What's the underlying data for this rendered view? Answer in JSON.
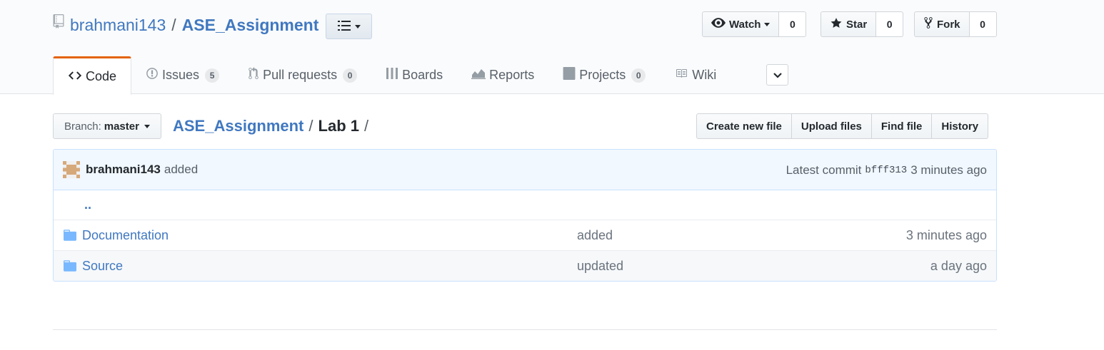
{
  "repo": {
    "owner": "brahmani143",
    "separator": "/",
    "name": "ASE_Assignment"
  },
  "actions": {
    "watch": {
      "label": "Watch",
      "count": "0"
    },
    "star": {
      "label": "Star",
      "count": "0"
    },
    "fork": {
      "label": "Fork",
      "count": "0"
    }
  },
  "tabs": [
    {
      "label": "Code",
      "icon": "code-icon"
    },
    {
      "label": "Issues",
      "count": "5",
      "icon": "issue-icon"
    },
    {
      "label": "Pull requests",
      "count": "0",
      "icon": "pull-request-icon"
    },
    {
      "label": "Boards",
      "icon": "boards-icon"
    },
    {
      "label": "Reports",
      "icon": "graph-icon"
    },
    {
      "label": "Projects",
      "count": "0",
      "icon": "project-icon"
    },
    {
      "label": "Wiki",
      "icon": "book-icon"
    }
  ],
  "branch": {
    "label": "Branch:",
    "value": "master"
  },
  "breadcrumb": {
    "root": "ASE_Assignment",
    "sep1": "/",
    "current": "Lab 1",
    "sep2": "/"
  },
  "file_buttons": {
    "create": "Create new file",
    "upload": "Upload files",
    "find": "Find file",
    "history": "History"
  },
  "commit": {
    "author": "brahmani143",
    "message": "added",
    "latest_label": "Latest commit",
    "sha": "bfff313",
    "age": "3 minutes ago"
  },
  "files": {
    "up": "..",
    "rows": [
      {
        "name": "Documentation",
        "message": "added",
        "age": "3 minutes ago"
      },
      {
        "name": "Source",
        "message": "updated",
        "age": "a day ago"
      }
    ]
  },
  "colors": {
    "link": "#4078c0",
    "tab_accent": "#e36209",
    "commit_bg": "#f1f8ff",
    "folder": "#79b8ff"
  }
}
